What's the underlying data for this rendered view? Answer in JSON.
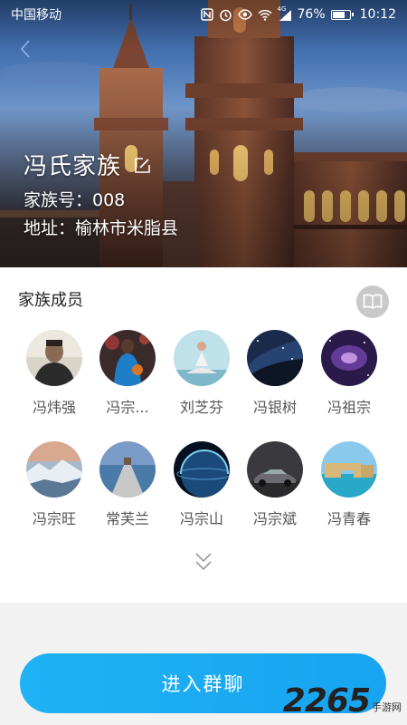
{
  "status_bar": {
    "carrier": "中国移动",
    "signal": "4G",
    "battery_text": "76%",
    "battery_level": 0.76,
    "time": "10:12"
  },
  "header": {
    "back_icon": "chevron-left-icon",
    "family_name": "冯氏家族",
    "edit_icon": "edit-icon",
    "family_id_line": "家族号：008",
    "address_line": "地址：榆林市米脂县"
  },
  "members_section": {
    "title": "家族成员",
    "book_icon": "book-icon",
    "members": [
      {
        "name": "冯炜强",
        "avatar": "man-portrait"
      },
      {
        "name": "冯宗...",
        "avatar": "basketball-player"
      },
      {
        "name": "刘芝芬",
        "avatar": "yoga-woman"
      },
      {
        "name": "冯银树",
        "avatar": "night-sky"
      },
      {
        "name": "冯祖宗",
        "avatar": "purple-galaxy"
      },
      {
        "name": "冯宗旺",
        "avatar": "ice-landscape"
      },
      {
        "name": "常芙兰",
        "avatar": "pier-sunset"
      },
      {
        "name": "冯宗山",
        "avatar": "planet"
      },
      {
        "name": "冯宗斌",
        "avatar": "sports-car"
      },
      {
        "name": "冯青春",
        "avatar": "sea-arch"
      }
    ],
    "expand_icon": "double-chevron-down-icon"
  },
  "footer": {
    "enter_button_label": "进入群聊"
  },
  "watermark": {
    "number": "2265",
    "sub": "手游网"
  },
  "colors": {
    "primary": "#1ba9f2",
    "card_bg": "#ffffff",
    "page_bg": "#f2f2f2"
  }
}
